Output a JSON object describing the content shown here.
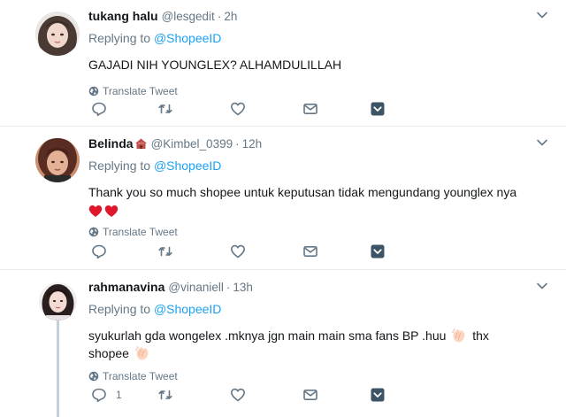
{
  "tweets": [
    {
      "name": "tukang halu",
      "handle": "@lesgedit",
      "dot": "·",
      "time": "2h",
      "replying_prefix": "Replying to",
      "replying_to": "@ShopeeID",
      "text": "GAJADI NIH YOUNGLEX? ALHAMDULILLAH",
      "translate_label": "Translate Tweet",
      "reply_count": ""
    },
    {
      "name": "Belinda",
      "handle": "@Kimbel_0399",
      "dot": "·",
      "time": "12h",
      "replying_prefix": "Replying to",
      "replying_to": "@ShopeeID",
      "text": "Thank you so much shopee untuk keputusan tidak mengundang younglex nya",
      "translate_label": "Translate Tweet",
      "reply_count": ""
    },
    {
      "name": "rahmanavina",
      "handle": "@vinaniell",
      "dot": "·",
      "time": "13h",
      "replying_prefix": "Replying to",
      "replying_to": "@ShopeeID",
      "text_part1": "syukurlah gda wongelex .mknya jgn main main sma fans BP .huu",
      "text_part2": "thx",
      "text_part3": "shopee",
      "translate_label": "Translate Tweet",
      "reply_count": "1"
    }
  ],
  "icons": {
    "reply": "reply-icon",
    "retweet": "retweet-icon",
    "like": "heart-icon",
    "dm": "envelope-icon",
    "more": "chevron-down-box-icon",
    "caret": "chevron-down-icon",
    "globe": "globe-icon"
  },
  "colors": {
    "link": "#1da1f2",
    "muted": "#657786",
    "text": "#14171a",
    "border": "#e6ecf0",
    "heart_emoji": "#e0162b",
    "thread_line": "#c4cfd6"
  }
}
